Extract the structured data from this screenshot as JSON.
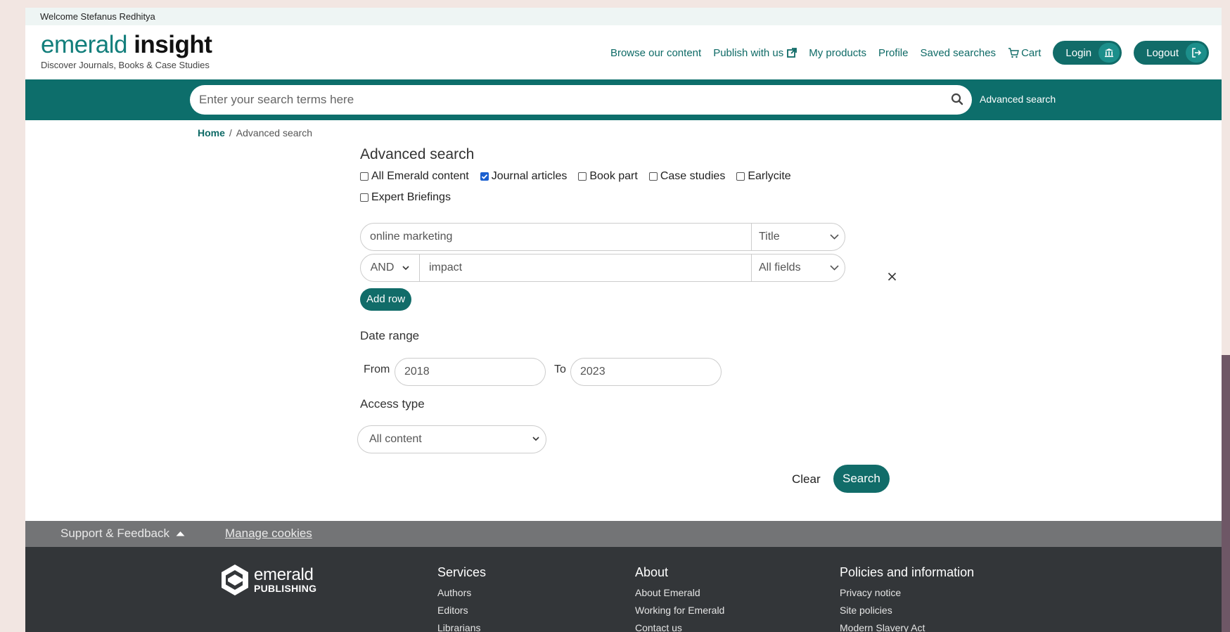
{
  "welcome": "Welcome Stefanus Redhitya",
  "logo": {
    "part1": "emerald",
    "part2": "insight",
    "tagline": "Discover Journals, Books & Case Studies"
  },
  "nav": {
    "browse": "Browse our content",
    "publish": "Publish with us",
    "products": "My products",
    "profile": "Profile",
    "saved": "Saved searches",
    "cart": "Cart",
    "login": "Login",
    "logout": "Logout"
  },
  "search": {
    "placeholder": "Enter your search terms here",
    "advanced_link": "Advanced search"
  },
  "breadcrumb": {
    "home": "Home",
    "separator": "/",
    "current": "Advanced search"
  },
  "form": {
    "title": "Advanced search",
    "content_types": [
      {
        "label": "All Emerald content",
        "checked": false
      },
      {
        "label": "Journal articles",
        "checked": true
      },
      {
        "label": "Book part",
        "checked": false
      },
      {
        "label": "Case studies",
        "checked": false
      },
      {
        "label": "Earlycite",
        "checked": false
      },
      {
        "label": "Expert Briefings",
        "checked": false
      }
    ],
    "rows": [
      {
        "term": "online marketing",
        "field": "Title"
      },
      {
        "operator": "AND",
        "term": "impact",
        "field": "All fields"
      }
    ],
    "add_row": "Add row",
    "date_range_label": "Date range",
    "from_label": "From",
    "from_value": "2018",
    "to_label": "To",
    "to_value": "2023",
    "access_label": "Access type",
    "access_value": "All content",
    "clear": "Clear",
    "search": "Search"
  },
  "supportbar": {
    "support": "Support & Feedback",
    "cookies": "Manage cookies"
  },
  "footer": {
    "logo_line1": "emerald",
    "logo_line2": "PUBLISHING",
    "services": {
      "heading": "Services",
      "links": [
        "Authors",
        "Editors",
        "Librarians"
      ]
    },
    "about": {
      "heading": "About",
      "links": [
        "About Emerald",
        "Working for Emerald",
        "Contact us"
      ]
    },
    "policies": {
      "heading": "Policies and information",
      "links": [
        "Privacy notice",
        "Site policies",
        "Modern Slavery Act"
      ]
    }
  },
  "colors": {
    "brand_teal": "#0d6e6b",
    "link_teal": "#0e6a66",
    "footer_dark": "#333639",
    "support_grey": "#737476"
  }
}
